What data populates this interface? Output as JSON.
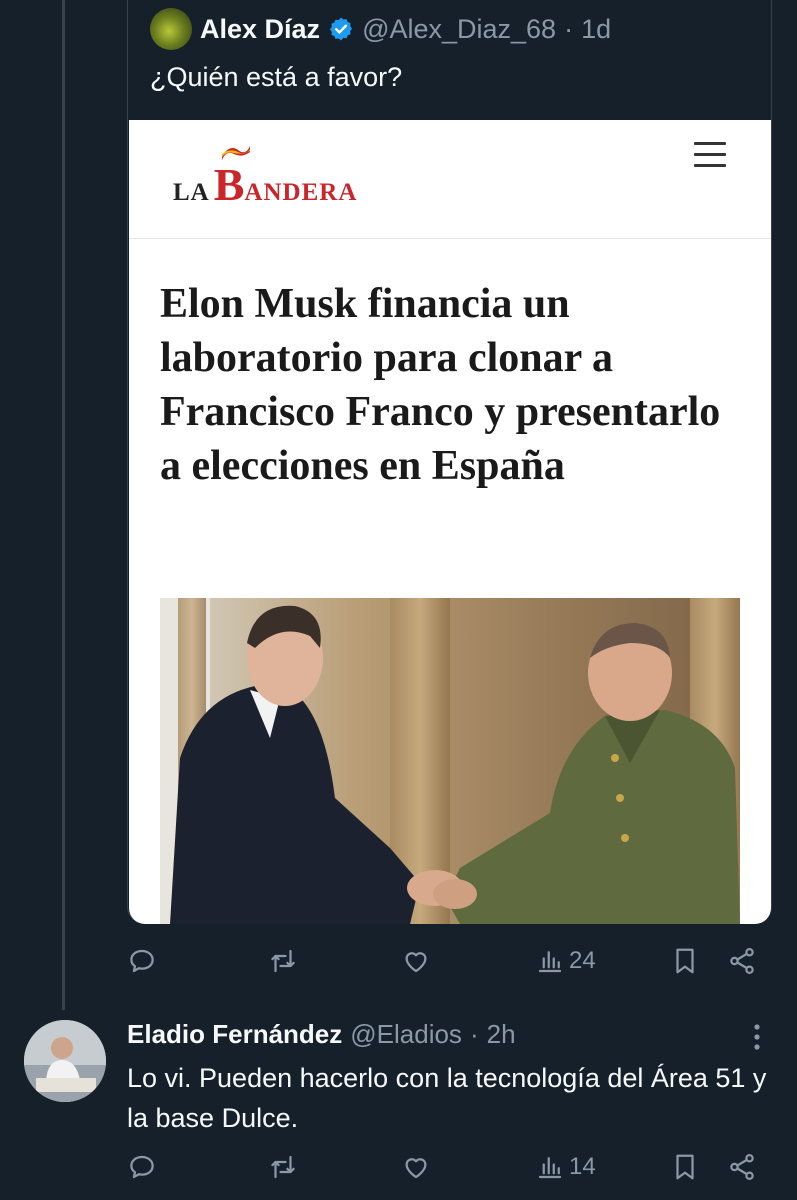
{
  "quoted_tweet": {
    "author_name": "Alex Díaz",
    "handle": "@Alex_Diaz_68",
    "separator": "·",
    "time": "1d",
    "text": "¿Quién está a favor?",
    "verified_color": "#1d9bf0",
    "article": {
      "logo_la": "LA",
      "logo_b": "B",
      "logo_rest": "ANDERA",
      "logo_color": "#c9252b",
      "headline": "Elon Musk financia un laboratorio para clonar a Francisco Franco y presentarlo a elecciones en España"
    },
    "actions": {
      "views_count": "24"
    }
  },
  "reply": {
    "author_name": "Eladio Fernández",
    "handle": "@Eladios",
    "separator": "·",
    "time": "2h",
    "text": "Lo vi. Pueden hacerlo con la tecnología del Área 51 y la base Dulce.",
    "actions": {
      "views_count": "14"
    }
  },
  "icons": [
    "reply-icon",
    "retweet-icon",
    "like-icon",
    "views-icon",
    "bookmark-icon",
    "share-icon",
    "more-icon",
    "verified-badge-icon",
    "menu-icon"
  ],
  "colors": {
    "background": "#15202b",
    "text": "#f7f9f9",
    "secondary": "#8b98a5",
    "border": "#38444d"
  }
}
